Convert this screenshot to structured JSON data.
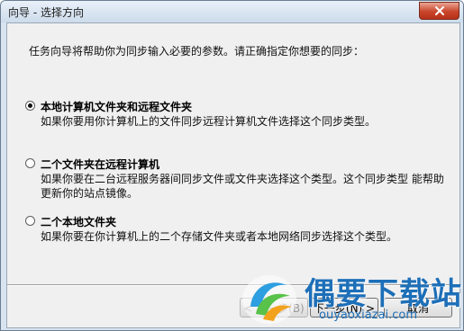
{
  "window": {
    "title": "向导 - 选择方向",
    "close_icon": "close-icon"
  },
  "wizard": {
    "intro": "任务向导将帮助你为同步输入必要的参数。请正确指定你想要的同步："
  },
  "options": [
    {
      "label": "本地计算机文件夹和远程文件夹",
      "desc": "如果你要用你计算机上的文件同步远程计算机文件选择这个同步类型。",
      "checked": true
    },
    {
      "label": "二个文件夹在远程计算机",
      "desc": "如果你要在二台远程服务器间同步文件或文件夹选择这个类型。这个同步类型 能帮助更新你的站点镜像。",
      "checked": false
    },
    {
      "label": "二个本地文件夹",
      "desc": "如果你要在你计算机上的二个存储文件夹或者本地网络同步选择这个类型。",
      "checked": false
    }
  ],
  "buttons": {
    "back": "< 上一步(B)",
    "next": "下一步(N) >",
    "cancel": "取消"
  },
  "watermark": {
    "brand": "偶要下载站",
    "url": "ouyaoxiazai.com"
  }
}
